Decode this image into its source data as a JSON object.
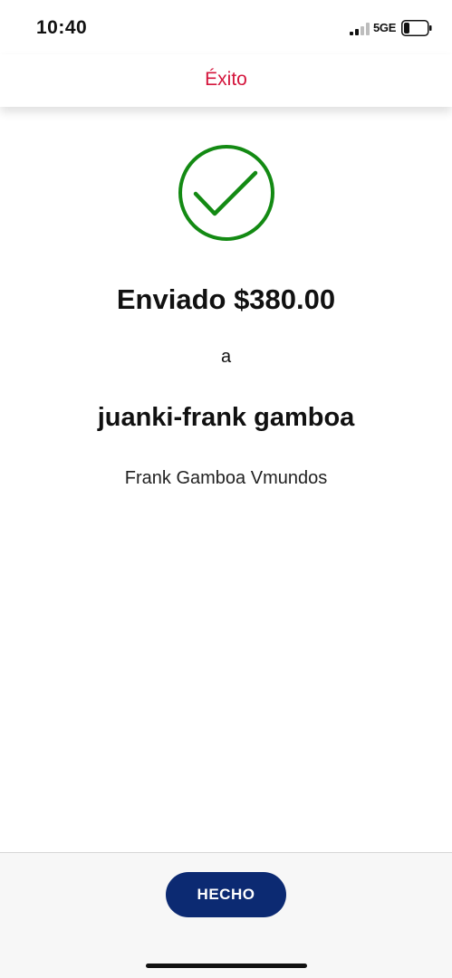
{
  "status_bar": {
    "time": "10:40",
    "network": "5GE",
    "icons": [
      "signal-icon",
      "battery-icon"
    ]
  },
  "nav": {
    "title": "Éxito"
  },
  "result": {
    "icon": "check-circle-icon",
    "amount_text": "Enviado $380.00",
    "to_label": "a",
    "recipient_handle": "juanki-frank gamboa",
    "recipient_name": "Frank Gamboa Vmundos"
  },
  "footer": {
    "done_label": "HECHO"
  },
  "colors": {
    "title_red": "#d4153c",
    "success_green": "#138a13",
    "button_navy": "#0c2a72",
    "footer_bg": "#f7f7f7"
  }
}
